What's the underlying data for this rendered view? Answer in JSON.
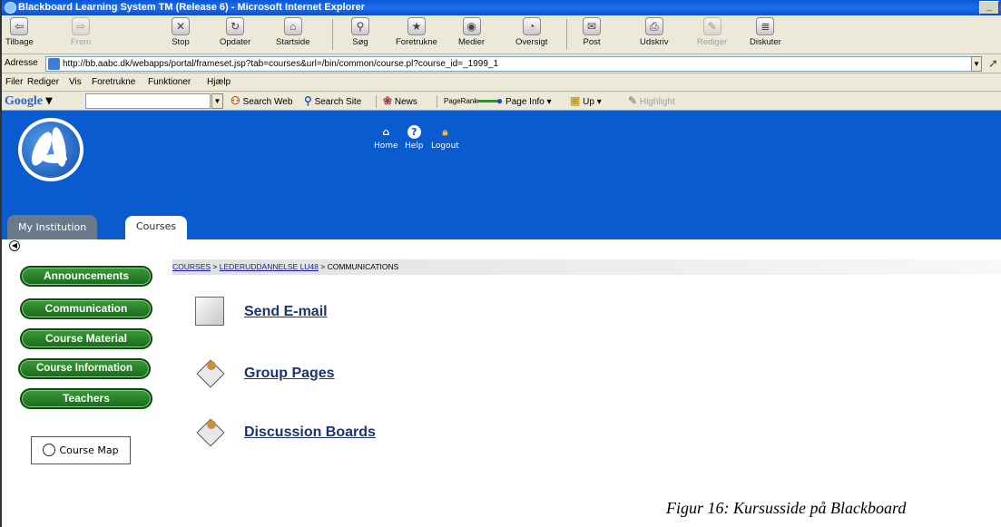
{
  "window": {
    "title": "Blackboard Learning System TM (Release 6) - Microsoft Internet Explorer"
  },
  "toolbar": [
    {
      "label": "Tilbage",
      "icon": "back-arrow-icon",
      "disabled": false
    },
    {
      "label": "Frem",
      "icon": "forward-arrow-icon",
      "disabled": true
    },
    {
      "label": "Stop",
      "icon": "stop-icon",
      "disabled": false
    },
    {
      "label": "Opdater",
      "icon": "refresh-icon",
      "disabled": false
    },
    {
      "label": "Startside",
      "icon": "home-icon",
      "disabled": false
    },
    {
      "label": "Søg",
      "icon": "search-icon",
      "disabled": false
    },
    {
      "label": "Foretrukne",
      "icon": "favorites-icon",
      "disabled": false
    },
    {
      "label": "Medier",
      "icon": "media-icon",
      "disabled": false
    },
    {
      "label": "Oversigt",
      "icon": "history-icon",
      "disabled": false
    },
    {
      "label": "Post",
      "icon": "mail-icon",
      "disabled": false
    },
    {
      "label": "Udskriv",
      "icon": "print-icon",
      "disabled": false
    },
    {
      "label": "Rediger",
      "icon": "edit-icon",
      "disabled": true
    },
    {
      "label": "Diskuter",
      "icon": "discuss-icon",
      "disabled": false
    }
  ],
  "address": {
    "label": "Adresse",
    "url": "http://bb.aabc.dk/webapps/portal/frameset.jsp?tab=courses&url=/bin/common/course.pl?course_id=_1999_1"
  },
  "menu": [
    "Filer",
    "Rediger",
    "Vis",
    "Foretrukne",
    "Funktioner",
    "Hjælp"
  ],
  "google": {
    "logo": "Google",
    "items": [
      "Search Web",
      "Search Site",
      "News",
      "PageRank",
      "Page Info",
      "Up",
      "Highlight"
    ]
  },
  "header": {
    "links": [
      {
        "label": "Home",
        "icon": "home-building-icon"
      },
      {
        "label": "Help",
        "icon": "help-icon"
      },
      {
        "label": "Logout",
        "icon": "lock-icon"
      }
    ],
    "tabs": [
      "My Institution",
      "Courses"
    ]
  },
  "nav": [
    "Announcements",
    "Communication",
    "Course Material",
    "Course Information",
    "Teachers"
  ],
  "course_map": "Course Map",
  "breadcrumb": {
    "courses": "COURSES",
    "course": "LEDERUDDANNELSE LU48",
    "current": "COMMUNICATIONS",
    "separator": ">"
  },
  "items": [
    {
      "label": "Send E-mail",
      "icon": "email-icon"
    },
    {
      "label": "Group Pages",
      "icon": "group-pages-icon"
    },
    {
      "label": "Discussion Boards",
      "icon": "discussion-board-icon"
    }
  ],
  "caption": "Figur 16: Kursusside på Blackboard",
  "colors": {
    "banner": "#0a5ad0",
    "nav_button": "#1a6a1a",
    "link": "#1a3470"
  }
}
